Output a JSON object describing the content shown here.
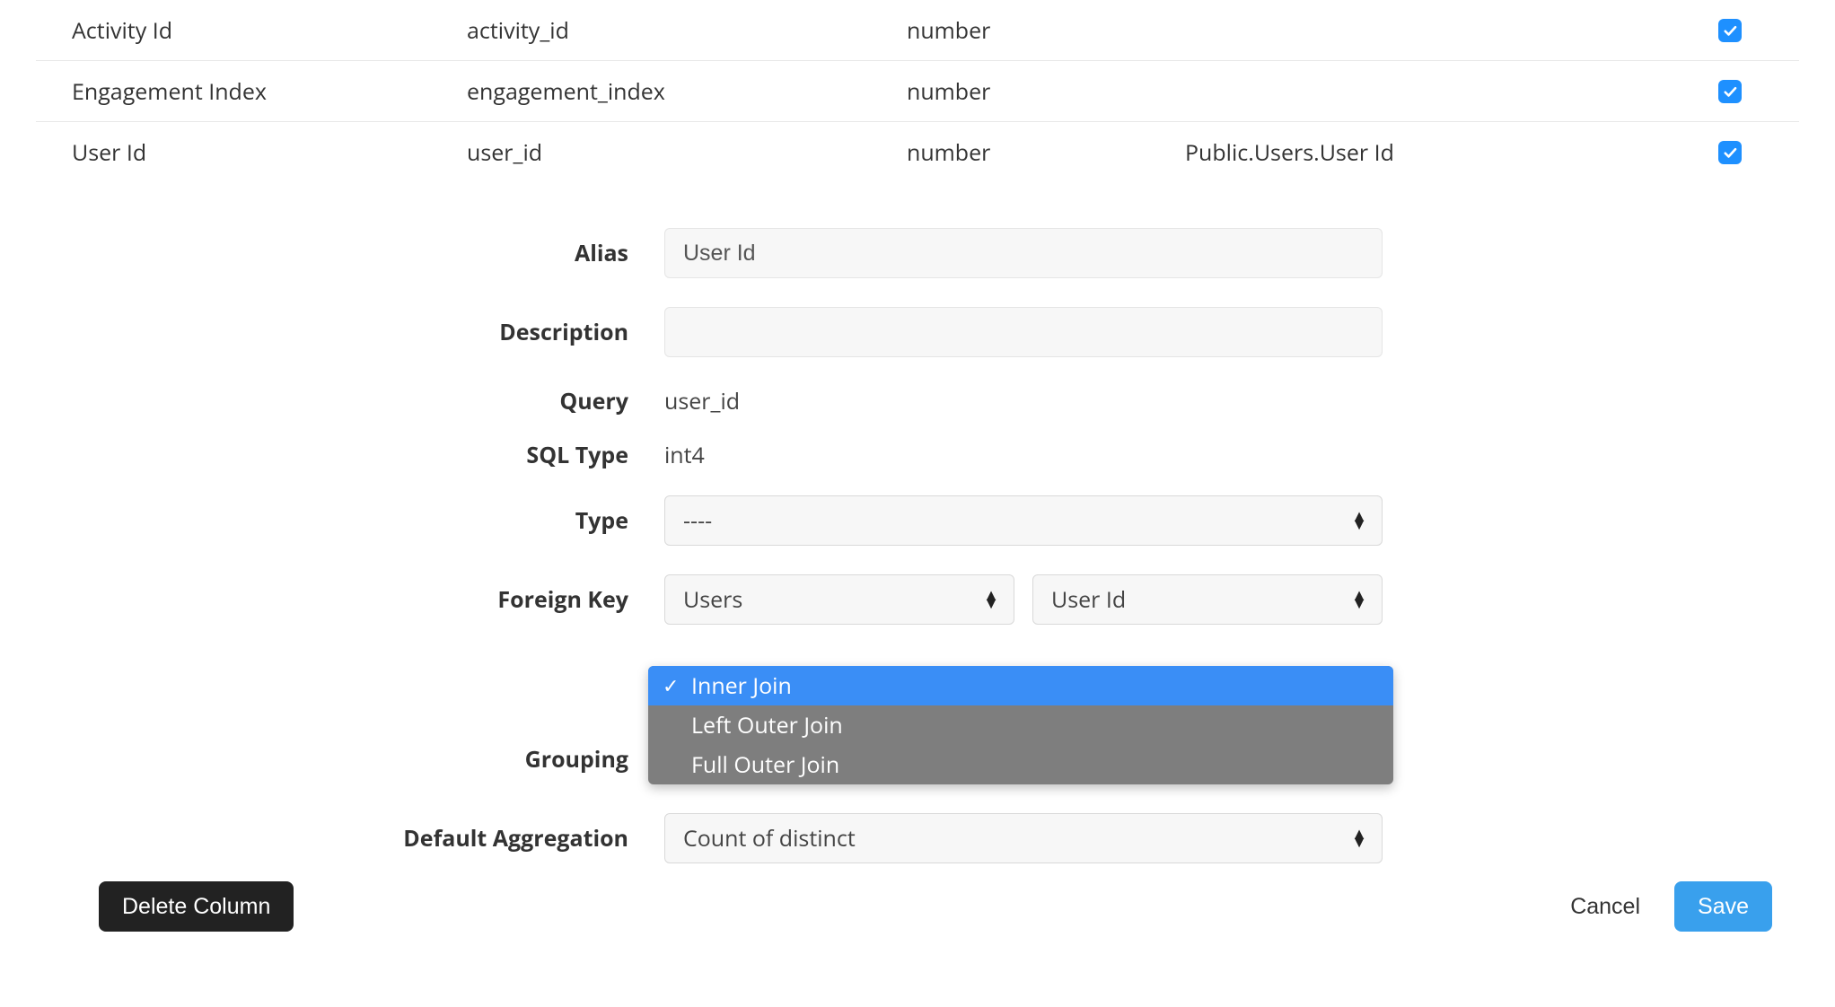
{
  "table": {
    "rows": [
      {
        "alias": "Activity Id",
        "col": "activity_id",
        "type": "number",
        "fk": "",
        "checked": true
      },
      {
        "alias": "Engagement Index",
        "col": "engagement_index",
        "type": "number",
        "fk": "",
        "checked": true
      },
      {
        "alias": "User Id",
        "col": "user_id",
        "type": "number",
        "fk": "Public.Users.User Id",
        "checked": true
      }
    ]
  },
  "form": {
    "labels": {
      "alias": "Alias",
      "description": "Description",
      "query": "Query",
      "sql_type": "SQL Type",
      "type": "Type",
      "foreign_key": "Foreign Key",
      "grouping": "Grouping",
      "default_aggregation": "Default Aggregation"
    },
    "values": {
      "alias": "User Id",
      "description": "",
      "query": "user_id",
      "sql_type": "int4",
      "type": "----",
      "fk_table": "Users",
      "fk_column": "User Id",
      "default_aggregation": "Count of distinct"
    },
    "join_options": {
      "selected": "Inner Join",
      "options": [
        "Inner Join",
        "Left Outer Join",
        "Full Outer Join"
      ]
    }
  },
  "buttons": {
    "delete": "Delete Column",
    "cancel": "Cancel",
    "save": "Save"
  }
}
